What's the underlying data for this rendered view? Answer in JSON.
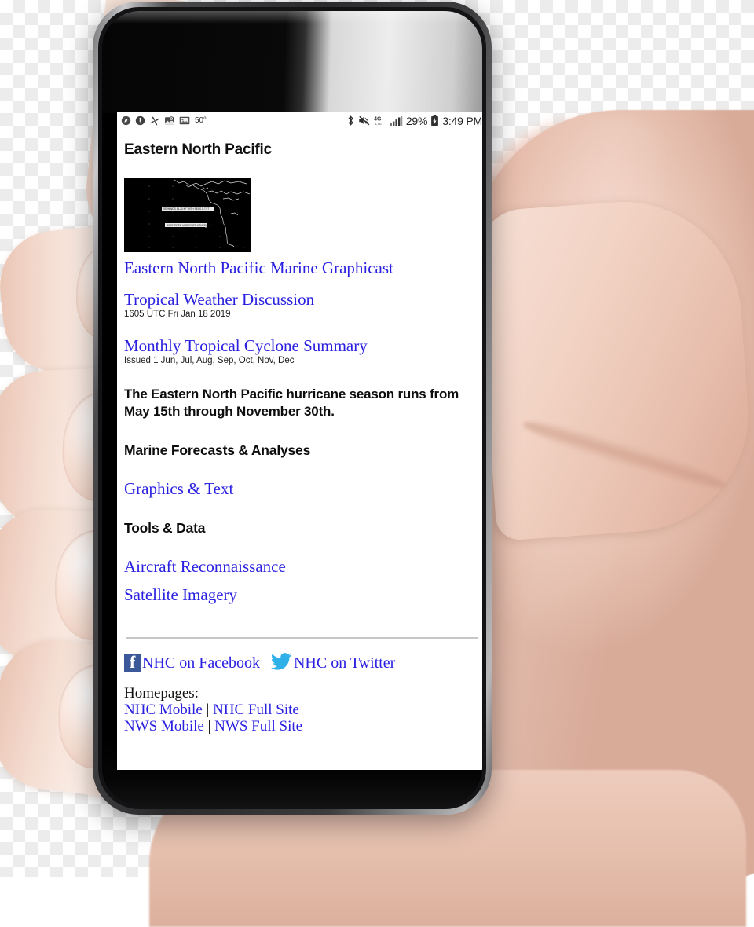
{
  "status_bar": {
    "left_icons": [
      {
        "name": "compass-icon",
        "glyph": "compass"
      },
      {
        "name": "alert-circle-icon",
        "glyph": "exclamation"
      },
      {
        "name": "sync-pinwheel-icon",
        "glyph": "pinwheel"
      },
      {
        "name": "map-location-icon",
        "glyph": "map"
      },
      {
        "name": "photo-image-icon",
        "glyph": "image"
      }
    ],
    "temperature": "50°",
    "right_icons": [
      {
        "name": "bluetooth-icon",
        "glyph": "bluetooth"
      },
      {
        "name": "mute-vibrate-icon",
        "glyph": "mute"
      },
      {
        "name": "lte-4g-icon",
        "glyph": "4G"
      },
      {
        "name": "signal-bars-icon",
        "glyph": "signal"
      }
    ],
    "battery_percent": "29%",
    "clock": "3:49 PM"
  },
  "page": {
    "title": "Eastern North Pacific",
    "graphicast": {
      "thumbnail_alt": "Eastern North Pacific marine graphicast map",
      "link_label": "Eastern North Pacific Marine Graphicast"
    },
    "items": [
      {
        "link_label": "Tropical Weather Discussion",
        "caption": "1605 UTC Fri Jan 18 2019"
      },
      {
        "link_label": "Monthly Tropical Cyclone Summary",
        "caption": "Issued 1 Jun, Jul, Aug, Sep, Oct, Nov, Dec"
      }
    ],
    "season_note": "The Eastern North Pacific hurricane season runs from May 15th through November 30th.",
    "sections": [
      {
        "heading": "Marine Forecasts & Analyses",
        "links": [
          "Graphics & Text"
        ]
      },
      {
        "heading": "Tools & Data",
        "links": [
          "Aircraft Reconnaissance",
          "Satellite Imagery"
        ]
      }
    ],
    "social": {
      "facebook_label": "NHC on Facebook",
      "twitter_label": "NHC on Twitter",
      "facebook_color": "#3b5998",
      "twitter_color": "#2fb0e8"
    },
    "footer": {
      "homepages_label": "Homepages:",
      "rows": [
        {
          "left": "NHC Mobile",
          "separator": "|",
          "right": "NHC Full Site"
        },
        {
          "left": "NWS Mobile",
          "separator": "|",
          "right": "NWS Full Site"
        }
      ]
    },
    "link_color": "#2a20e0"
  }
}
